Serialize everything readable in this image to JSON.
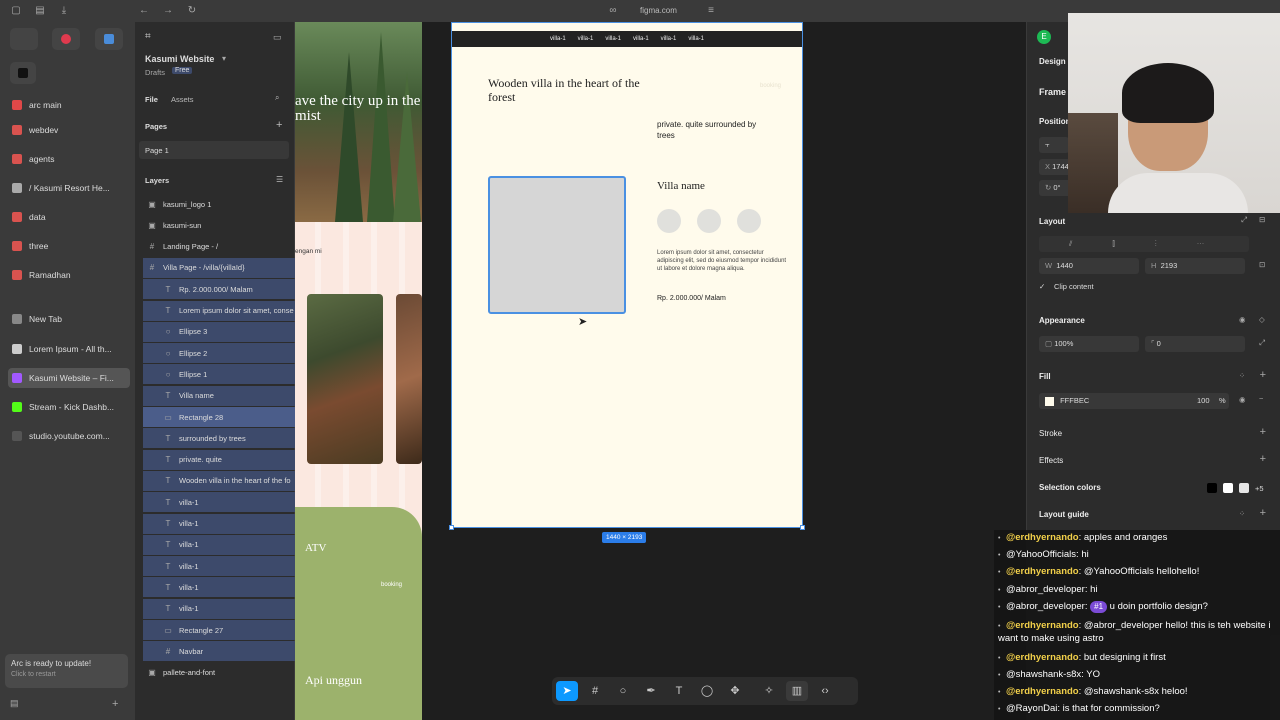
{
  "browser": {
    "url": "figma.com"
  },
  "arc": {
    "items": [
      {
        "label": "arc main",
        "color": "#e04848"
      },
      {
        "label": "webdev",
        "color": "#d9534f"
      },
      {
        "label": "agents",
        "color": "#d9534f"
      },
      {
        "label": "/ Kasumi Resort He...",
        "color": "#aaaaaa"
      },
      {
        "label": "data",
        "color": "#d9534f"
      },
      {
        "label": "three",
        "color": "#d9534f"
      },
      {
        "label": "Ramadhan",
        "color": "#d9534f"
      },
      {
        "label": "New Tab",
        "color": "#888888"
      },
      {
        "label": "Lorem Ipsum - All th...",
        "color": "#cccccc"
      },
      {
        "label": "Kasumi Website – Fi...",
        "color": "#a259ff"
      },
      {
        "label": "Stream - Kick Dashb...",
        "color": "#53fc18"
      },
      {
        "label": "studio.youtube.com...",
        "color": "#555555"
      }
    ],
    "update_title": "Arc is ready to update!",
    "update_sub": "Click to restart"
  },
  "left_panel": {
    "file_name": "Kasumi Website",
    "drafts": "Drafts",
    "plan": "Free",
    "tab_file": "File",
    "tab_assets": "Assets",
    "pages_header": "Pages",
    "page_1": "Page 1",
    "layers_header": "Layers",
    "layers": [
      {
        "label": "kasumi_logo 1",
        "icon": "▣",
        "indent": 0
      },
      {
        "label": "kasumi-sun",
        "icon": "▣",
        "indent": 0
      },
      {
        "label": "Landing Page - /",
        "icon": "#",
        "indent": 0
      },
      {
        "label": "Villa Page - /villa/{villaId}",
        "icon": "#",
        "indent": 0,
        "selected": "frame"
      },
      {
        "label": "Rp. 2.000.000/ Malam",
        "icon": "T",
        "indent": 1
      },
      {
        "label": "Lorem ipsum dolor sit amet, conse",
        "icon": "T",
        "indent": 1
      },
      {
        "label": "Ellipse 3",
        "icon": "○",
        "indent": 1
      },
      {
        "label": "Ellipse 2",
        "icon": "○",
        "indent": 1
      },
      {
        "label": "Ellipse 1",
        "icon": "○",
        "indent": 1
      },
      {
        "label": "Villa name",
        "icon": "T",
        "indent": 1
      },
      {
        "label": "Rectangle 28",
        "icon": "▭",
        "indent": 1,
        "selected": "layer"
      },
      {
        "label": "surrounded by trees",
        "icon": "T",
        "indent": 1
      },
      {
        "label": "private. quite",
        "icon": "T",
        "indent": 1
      },
      {
        "label": "Wooden villa in the heart of the fo",
        "icon": "T",
        "indent": 1
      },
      {
        "label": "villa-1",
        "icon": "T",
        "indent": 1
      },
      {
        "label": "villa-1",
        "icon": "T",
        "indent": 1
      },
      {
        "label": "villa-1",
        "icon": "T",
        "indent": 1
      },
      {
        "label": "villa-1",
        "icon": "T",
        "indent": 1
      },
      {
        "label": "villa-1",
        "icon": "T",
        "indent": 1
      },
      {
        "label": "villa-1",
        "icon": "T",
        "indent": 1
      },
      {
        "label": "Rectangle 27",
        "icon": "▭",
        "indent": 1
      },
      {
        "label": "Navbar",
        "icon": "#",
        "indent": 1
      },
      {
        "label": "pallete-and-font",
        "icon": "▣",
        "indent": 0
      }
    ]
  },
  "landing": {
    "title": "ave the city up in the mist",
    "dengan": "engan mi",
    "atv": "ATV",
    "booking": "booking",
    "api": "Api unggun"
  },
  "villa": {
    "nav_items": [
      "villa-1",
      "villa-1",
      "villa-1",
      "villa-1",
      "villa-1",
      "villa-1"
    ],
    "title": "Wooden villa in the heart of the forest",
    "booking": "booking",
    "private": "private. quite surrounded by trees",
    "villa_name": "Villa name",
    "lorem": "Lorem ipsum dolor sit amet, consectetur adipiscing elit, sed do eiusmod tempor incididunt ut labore et dolore magna aliqua.",
    "price": "Rp. 2.000.000/ Malam",
    "dims": "1440 × 2193",
    "bg_color": "#FFFBEC"
  },
  "right_panel": {
    "avatar": "E",
    "tab_design": "Design",
    "frame": "Frame",
    "position": "Position",
    "x_label": "X",
    "x_value": "1744",
    "rotation": "0°",
    "layout": "Layout",
    "w_label": "W",
    "w_value": "1440",
    "h_label": "H",
    "h_value": "2193",
    "clip": "Clip content",
    "appearance": "Appearance",
    "opacity": "100%",
    "radius": "0",
    "fill": "Fill",
    "fill_hex": "FFFBEC",
    "fill_opacity": "100",
    "fill_unit": "%",
    "stroke": "Stroke",
    "effects": "Effects",
    "selection_colors": "Selection colors",
    "selection_more": "+5",
    "layout_guide": "Layout guide"
  },
  "chat": [
    {
      "user": "@erdhyernando",
      "text": "apples and oranges",
      "style": "gold"
    },
    {
      "user": "@YahooOfficials",
      "text": "hi",
      "style": "white"
    },
    {
      "user": "@erdhyernando",
      "text": "@YahooOfficials hellohello!",
      "style": "gold"
    },
    {
      "user": "@abror_developer",
      "text": "hi",
      "style": "white"
    },
    {
      "user": "@abror_developer",
      "text": "u doin portfolio design?",
      "style": "white",
      "pill": "#1"
    },
    {
      "user": "@erdhyernando",
      "text": "@abror_developer hello! this is teh website i want to make using astro",
      "style": "gold"
    },
    {
      "user": "@erdhyernando",
      "text": "but designing it first",
      "style": "gold"
    },
    {
      "user": "@shawshank-s8x",
      "text": "YO",
      "style": "white"
    },
    {
      "user": "@erdhyernando",
      "text": "@shawshank-s8x heloo!",
      "style": "gold"
    },
    {
      "user": "@RayonDai",
      "text": "is that for commission?",
      "style": "white"
    }
  ],
  "toolbar": {
    "tools": [
      "move",
      "frame",
      "shape",
      "pen",
      "text",
      "comment",
      "components",
      "ai",
      "devmode",
      "code"
    ]
  }
}
